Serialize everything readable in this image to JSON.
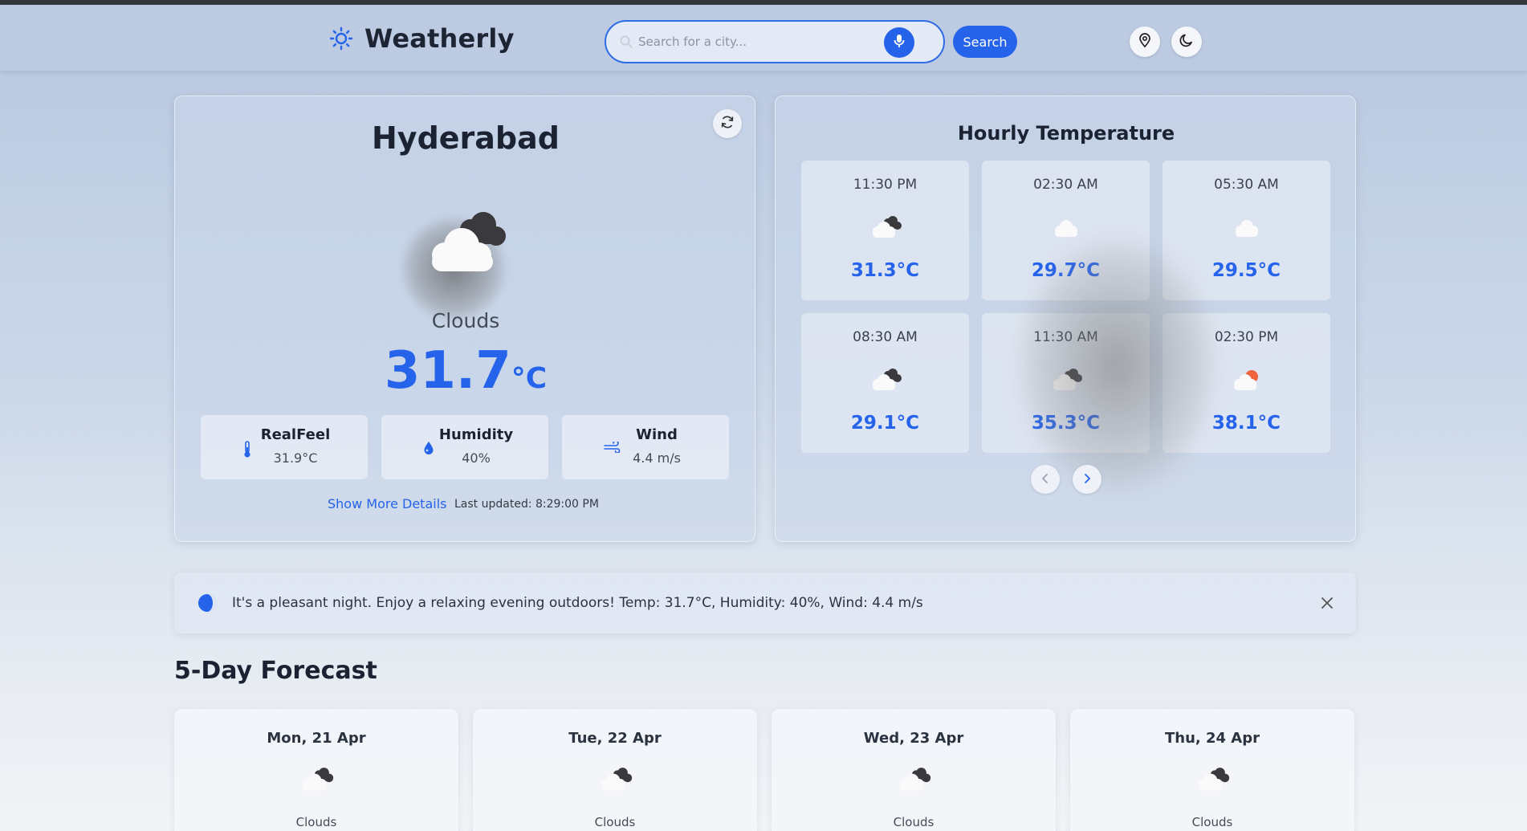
{
  "header": {
    "brand_name": "Weatherly",
    "search_placeholder": "Search for a city...",
    "search_button_label": "Search",
    "icons": [
      "sun-icon",
      "search-icon",
      "microphone-icon",
      "location-pin-icon",
      "moon-icon"
    ]
  },
  "current": {
    "city": "Hyderabad",
    "condition": "Clouds",
    "temperature": "31.7",
    "unit": "°C",
    "stats": [
      {
        "label": "RealFeel",
        "value": "31.9°C",
        "icon": "thermometer-icon"
      },
      {
        "label": "Humidity",
        "value": "40%",
        "icon": "droplet-icon"
      },
      {
        "label": "Wind",
        "value": "4.4 m/s",
        "icon": "wind-icon"
      }
    ],
    "more_details_label": "Show More Details",
    "last_updated": "Last updated: 8:29:00 PM"
  },
  "hourly": {
    "title": "Hourly Temperature",
    "items": [
      {
        "time": "11:30 PM",
        "temp": "31.3°C",
        "icon": "broken-clouds-icon"
      },
      {
        "time": "02:30 AM",
        "temp": "29.7°C",
        "icon": "cloud-icon"
      },
      {
        "time": "05:30 AM",
        "temp": "29.5°C",
        "icon": "cloud-icon"
      },
      {
        "time": "08:30 AM",
        "temp": "29.1°C",
        "icon": "broken-clouds-icon"
      },
      {
        "time": "11:30 AM",
        "temp": "35.3°C",
        "icon": "broken-clouds-icon"
      },
      {
        "time": "02:30 PM",
        "temp": "38.1°C",
        "icon": "sun-behind-cloud-icon"
      }
    ]
  },
  "notice": {
    "text": "It's a pleasant night. Enjoy a relaxing evening outdoors! Temp: 31.7°C, Humidity: 40%, Wind: 4.4 m/s"
  },
  "forecast": {
    "title": "5-Day Forecast",
    "days": [
      {
        "date": "Mon, 21 Apr",
        "condition": "Clouds"
      },
      {
        "date": "Tue, 22 Apr",
        "condition": "Clouds"
      },
      {
        "date": "Wed, 23 Apr",
        "condition": "Clouds"
      },
      {
        "date": "Thu, 24 Apr",
        "condition": "Clouds"
      }
    ]
  },
  "colors": {
    "accent": "#2563eb",
    "header_bg": "#bccbe2",
    "sun_orange": "#f0643c"
  }
}
